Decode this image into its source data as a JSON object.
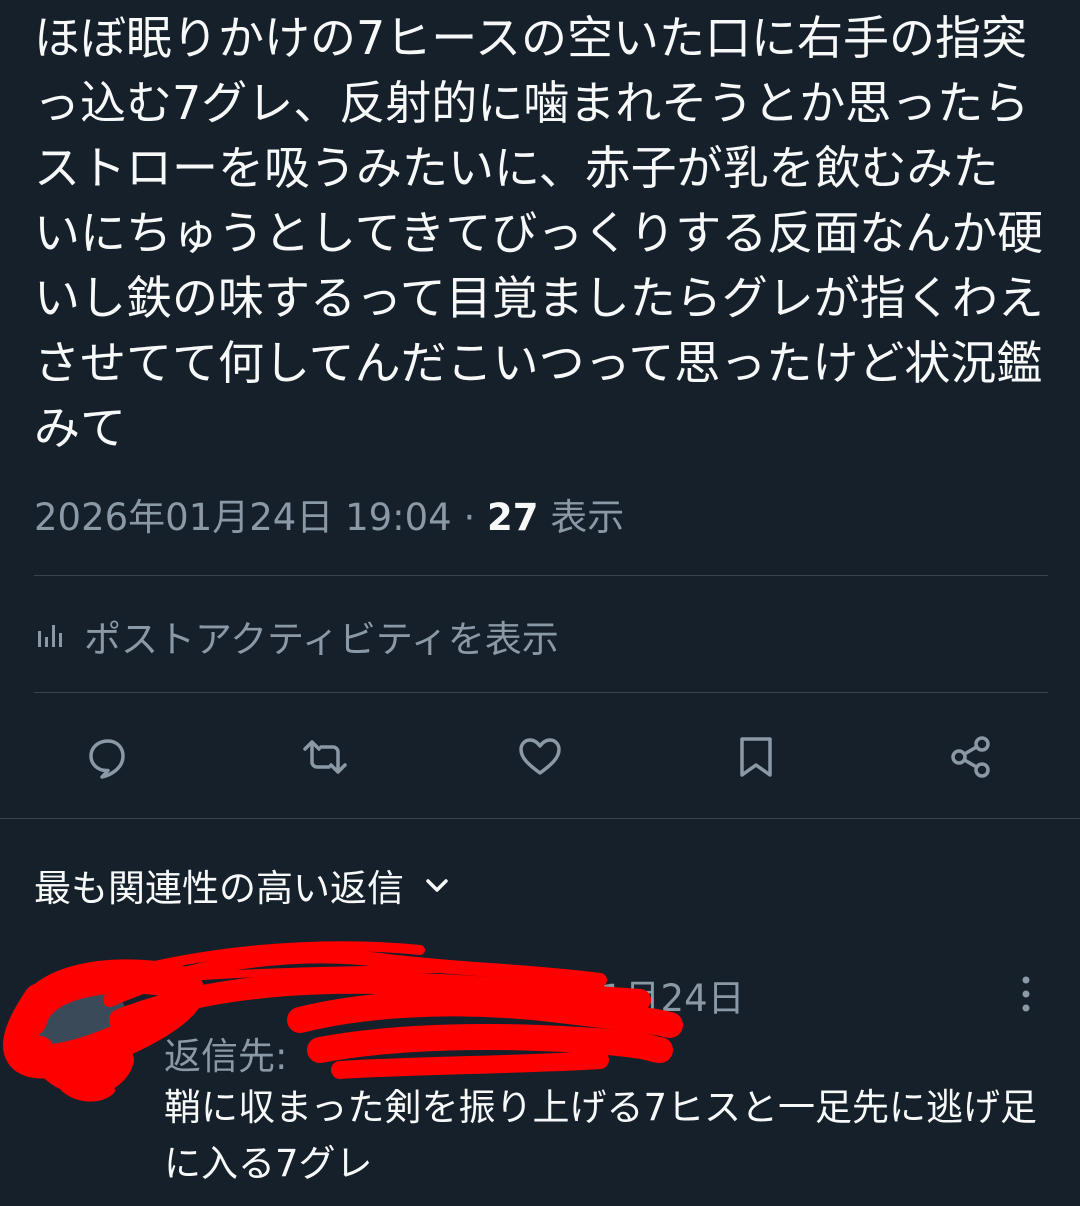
{
  "tweet": {
    "text": "ほぼ眠りかけの7ヒースの空いた口に右手の指突っ込む7グレ、反射的に噛まれそうとか思ったらストローを吸うみたいに、赤子が乳を飲むみたいにちゅうとしてきてびっくりする反面なんか硬いし鉄の味するって目覚ましたらグレが指くわえさせてて何してんだこいつって思ったけど状況鑑みて",
    "timestamp": "2026年01月24日 19:04",
    "separator": "·",
    "views_count": "27",
    "views_label": "表示"
  },
  "activity": {
    "label": "ポストアクティビティを表示",
    "icon": "bar-chart-icon"
  },
  "actions": {
    "reply_icon": "reply-icon",
    "retweet_icon": "retweet-icon",
    "like_icon": "like-icon",
    "bookmark_icon": "bookmark-icon",
    "share_icon": "share-icon"
  },
  "replies": {
    "sort_label": "最も関連性の高い返信",
    "items": [
      {
        "date": "1月24日",
        "reply_to_prefix": "返信先: ",
        "text": "鞘に収まった剣を振り上げる7ヒスと一足先に逃げ足に入る7グレ"
      }
    ]
  },
  "colors": {
    "background": "#15202b",
    "text": "#f7f9f9",
    "secondary": "#8b98a5",
    "divider": "#38444d",
    "redaction": "#ff0000"
  }
}
